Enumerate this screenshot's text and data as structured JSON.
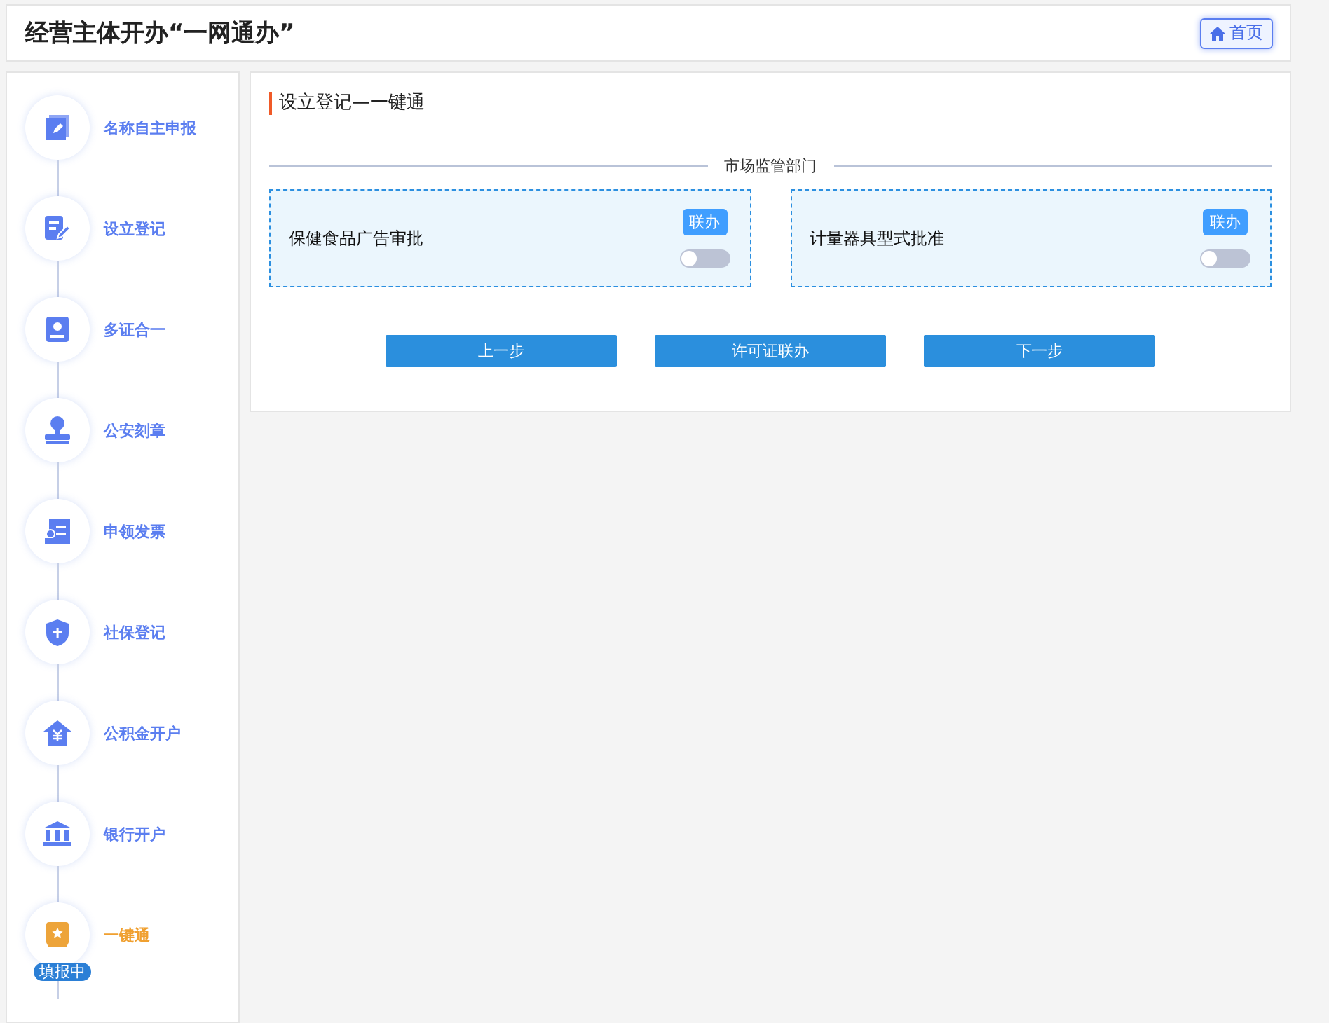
{
  "header": {
    "title": "经营主体开办“一网通办”",
    "home_button": "首页"
  },
  "steps": [
    {
      "label": "名称自主申报",
      "selected": false
    },
    {
      "label": "设立登记",
      "selected": false
    },
    {
      "label": "多证合一",
      "selected": false
    },
    {
      "label": "公安刻章",
      "selected": false
    },
    {
      "label": "申领发票",
      "selected": false
    },
    {
      "label": "社保登记",
      "selected": false
    },
    {
      "label": "公积金开户",
      "selected": false
    },
    {
      "label": "银行开户",
      "selected": false
    },
    {
      "label": "一键通",
      "selected": true,
      "badge": "填报中"
    }
  ],
  "panel": {
    "title": "设立登记—一键通",
    "section": "市场监管部门",
    "items": [
      {
        "name": "保健食品广告审批",
        "tag": "联办",
        "on": false
      },
      {
        "name": "计量器具型式批准",
        "tag": "联办",
        "on": false
      }
    ],
    "buttons": [
      "上一步",
      "许可证联办",
      "下一步"
    ]
  }
}
